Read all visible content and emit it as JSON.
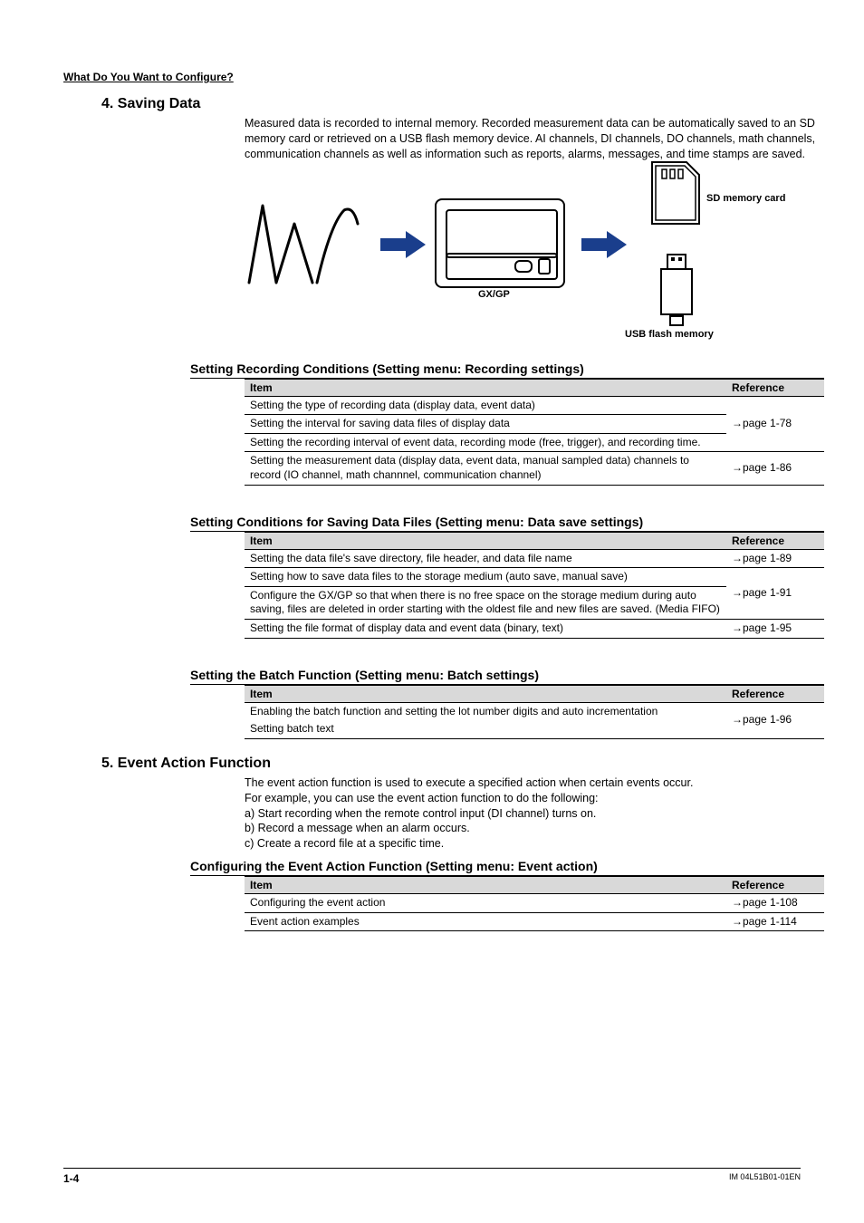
{
  "running_head": "What Do You Want to Configure?",
  "section4": {
    "title": "4. Saving Data",
    "intro": "Measured data is recorded to internal memory. Recorded measurement data can be automatically saved to an SD memory card or retrieved on a USB flash memory device. AI channels, DI channels, DO channels, math channels, communication channels as well as information such as reports, alarms, messages, and time stamps are saved.",
    "figure": {
      "gx_label": "GX/GP",
      "sd_label": "SD memory card",
      "usb_label": "USB flash memory"
    },
    "sub1": {
      "heading": "Setting Recording Conditions (Setting menu: Recording settings)",
      "th_item": "Item",
      "th_ref": "Reference",
      "rows": [
        {
          "item": "Setting the type of recording data (display data, event data)"
        },
        {
          "item": "Setting the interval for saving data files of display data"
        },
        {
          "item": "Setting the recording interval of event data, recording mode (free, trigger), and recording time."
        }
      ],
      "ref1": "→page 1-78",
      "row4": {
        "item": "Setting the measurement data (display data, event data, manual sampled data) channels to record (IO channel, math channnel, communication channel)",
        "ref": "→page 1-86"
      }
    },
    "sub2": {
      "heading": "Setting Conditions for Saving Data Files (Setting menu: Data save settings)",
      "th_item": "Item",
      "th_ref": "Reference",
      "r1": {
        "item": "Setting the data file's save directory, file header, and data file name",
        "ref": "→page 1-89"
      },
      "r2a": "Setting how to save data files to the storage medium (auto save, manual save)",
      "r2b": "Configure the GX/GP so that when there is no free space on the storage medium during auto saving, files are deleted in order starting with the oldest file and new files are saved. (Media FIFO)",
      "r2ref": "→page 1-91",
      "r3": {
        "item": "Setting the file format of display data and event data (binary, text)",
        "ref": "→page 1-95"
      }
    },
    "sub3": {
      "heading": "Setting the Batch Function (Setting menu: Batch settings)",
      "th_item": "Item",
      "th_ref": "Reference",
      "r1": "Enabling the batch function and setting the lot number digits and auto incrementation",
      "r2": "Setting batch text",
      "ref": "→page 1-96"
    }
  },
  "section5": {
    "title": "5. Event Action Function",
    "intro": "The event action function is used to execute a specified action when certain events occur.",
    "line2": "For example, you can use the event action function to do the following:",
    "la": "a) Start recording when the remote control input (DI channel) turns on.",
    "lb": "b) Record a message when an alarm occurs.",
    "lc": "c) Create a record file at a specific time.",
    "sub1": {
      "heading": "Configuring the Event Action Function (Setting menu: Event action)",
      "th_item": "Item",
      "th_ref": "Reference",
      "r1": {
        "item": "Configuring the event action",
        "ref": "→page 1-108"
      },
      "r2": {
        "item": "Event action examples",
        "ref": "→page 1-114"
      }
    }
  },
  "footer": {
    "page": "1-4",
    "docid": "IM 04L51B01-01EN"
  }
}
